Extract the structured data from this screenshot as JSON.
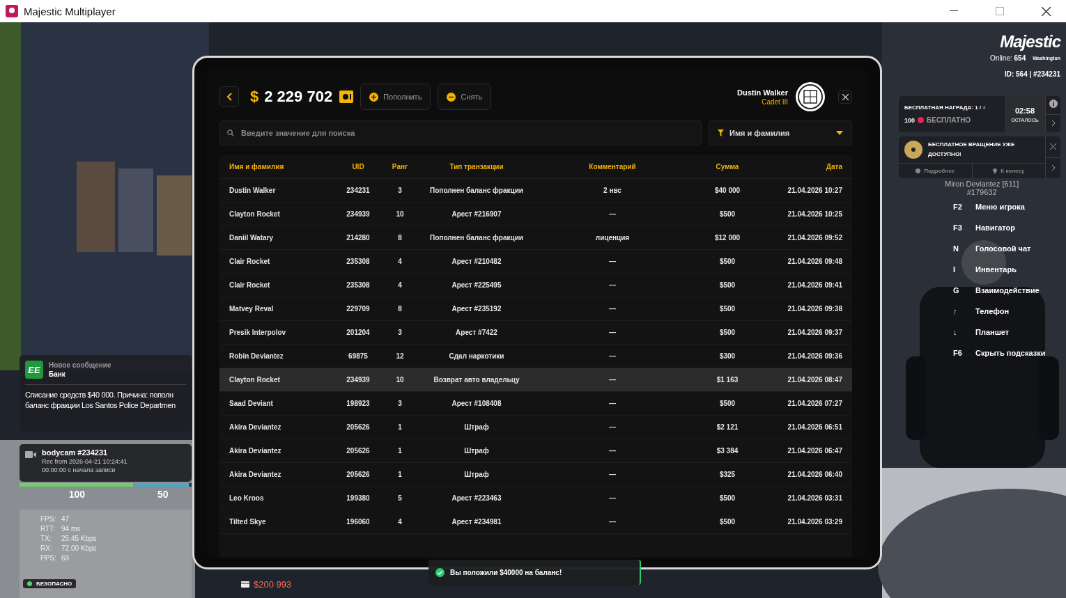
{
  "window": {
    "title": "Majestic Multiplayer"
  },
  "hud": {
    "logo": "Majestic",
    "online_label": "Online:",
    "online": "654",
    "server": "Washington",
    "id": "ID: 564 | #234231"
  },
  "reward": {
    "title": "БЕСПЛАТНАЯ НАГРАДА: 1 /",
    "total": "4",
    "amount": "100",
    "status": "БЕСПЛАТНО",
    "timer": "02:58",
    "timer_label": "ОСТАЛОСЬ"
  },
  "spin": {
    "title": "БЕСПЛАТНОЕ ВРАЩЕНИЕ УЖЕ ДОСТУПНО!",
    "actions": [
      {
        "kind": "info",
        "label": "Подробнее"
      },
      {
        "kind": "location",
        "label": "К колесу"
      }
    ]
  },
  "nametag": {
    "name": "Miron Deviantez [611]",
    "id": "#179632"
  },
  "hints": [
    {
      "key": "F2",
      "label": "Меню игрока"
    },
    {
      "key": "F3",
      "label": "Навигатор"
    },
    {
      "key": "N",
      "label": "Голосовой чат"
    },
    {
      "key": "I",
      "label": "Инвентарь"
    },
    {
      "key": "G",
      "label": "Взаимодействие"
    },
    {
      "key": "↑",
      "label": "Телефон"
    },
    {
      "key": "↓",
      "label": "Планшет"
    },
    {
      "key": "F6",
      "label": "Скрыть подсказки"
    }
  ],
  "notification": {
    "badge": "EE",
    "title": "Новое сообщение",
    "sender": "Банк",
    "lines": [
      "Списание средств $40 000. Причина: пополн",
      "баланс фракции Los Santos Police Departmen"
    ]
  },
  "bodycam": {
    "title": "bodycam #234231",
    "rec": "Rec from 2026-04-21 10:24:41",
    "elapsed": "00:00:00 с начала записи"
  },
  "vitals": [
    {
      "kind": "health",
      "value": "100",
      "level": 1
    },
    {
      "kind": "armor",
      "value": "50",
      "level": 0.95
    }
  ],
  "netstats": [
    {
      "label": "FPS:",
      "value": "47"
    },
    {
      "label": "RTT:",
      "value": "94 ms"
    },
    {
      "label": "TX:",
      "value": "25.45 Kbps"
    },
    {
      "label": "RX:",
      "value": "72.00 Kbps"
    },
    {
      "label": "PPS:",
      "value": "69"
    }
  ],
  "zone": {
    "label": "БЕЗОПАСНО"
  },
  "cash": {
    "bank": "$200 993"
  },
  "bank_panel": {
    "currency": "$",
    "balance": "2 229 702",
    "buttons": [
      {
        "kind": "deposit",
        "label": "Пополнить"
      },
      {
        "kind": "withdraw",
        "label": "Снять"
      }
    ],
    "user": {
      "name": "Dustin Walker",
      "rank": "Cadet III"
    },
    "search": {
      "placeholder": "Введите значение для поиска"
    },
    "filter": {
      "value": "Имя и фамилия"
    },
    "table": {
      "columns": [
        "Имя и фамилия",
        "UID",
        "Ранг",
        "Тип транзакции",
        "Комментарий",
        "Сумма",
        "Дата"
      ],
      "rows": [
        {
          "selected": false,
          "cells": [
            "Dustin Walker",
            "234231",
            "3",
            "Пополнен баланс фракции",
            "2 нвс",
            "$40 000",
            "21.04.2026 10:27"
          ]
        },
        {
          "selected": false,
          "cells": [
            "Clayton Rocket",
            "234939",
            "10",
            "Арест #216907",
            "—",
            "$500",
            "21.04.2026 10:25"
          ]
        },
        {
          "selected": false,
          "cells": [
            "Daniil Watary",
            "214280",
            "8",
            "Пополнен баланс фракции",
            "лиценция",
            "$12 000",
            "21.04.2026 09:52"
          ]
        },
        {
          "selected": false,
          "cells": [
            "Clair Rocket",
            "235308",
            "4",
            "Арест #210482",
            "—",
            "$500",
            "21.04.2026 09:48"
          ]
        },
        {
          "selected": false,
          "cells": [
            "Clair Rocket",
            "235308",
            "4",
            "Арест #225495",
            "—",
            "$500",
            "21.04.2026 09:41"
          ]
        },
        {
          "selected": false,
          "cells": [
            "Matvey Reval",
            "229709",
            "8",
            "Арест #235192",
            "—",
            "$500",
            "21.04.2026 09:38"
          ]
        },
        {
          "selected": false,
          "cells": [
            "Presik Interpolov",
            "201204",
            "3",
            "Арест #7422",
            "—",
            "$500",
            "21.04.2026 09:37"
          ]
        },
        {
          "selected": false,
          "cells": [
            "Robin Deviantez",
            "69875",
            "12",
            "Сдал наркотики",
            "—",
            "$300",
            "21.04.2026 09:36"
          ]
        },
        {
          "selected": true,
          "cells": [
            "Clayton Rocket",
            "234939",
            "10",
            "Возврат авто владельцу",
            "—",
            "$1 163",
            "21.04.2026 08:47"
          ]
        },
        {
          "selected": false,
          "cells": [
            "Saad Deviant",
            "198923",
            "3",
            "Арест #108408",
            "—",
            "$500",
            "21.04.2026 07:27"
          ]
        },
        {
          "selected": false,
          "cells": [
            "Akira Deviantez",
            "205626",
            "1",
            "Штраф",
            "—",
            "$2 121",
            "21.04.2026 06:51"
          ]
        },
        {
          "selected": false,
          "cells": [
            "Akira Deviantez",
            "205626",
            "1",
            "Штраф",
            "—",
            "$3 384",
            "21.04.2026 06:47"
          ]
        },
        {
          "selected": false,
          "cells": [
            "Akira Deviantez",
            "205626",
            "1",
            "Штраф",
            "—",
            "$325",
            "21.04.2026 06:40"
          ]
        },
        {
          "selected": false,
          "cells": [
            "Leo Kroos",
            "199380",
            "5",
            "Арест #223463",
            "—",
            "$500",
            "21.04.2026 03:31"
          ]
        },
        {
          "selected": false,
          "cells": [
            "Tilted Skye",
            "196060",
            "4",
            "Арест #234981",
            "—",
            "$500",
            "21.04.2026 03:29"
          ]
        }
      ]
    }
  },
  "toast": {
    "text": "Вы положили $40000 на баланс!"
  }
}
